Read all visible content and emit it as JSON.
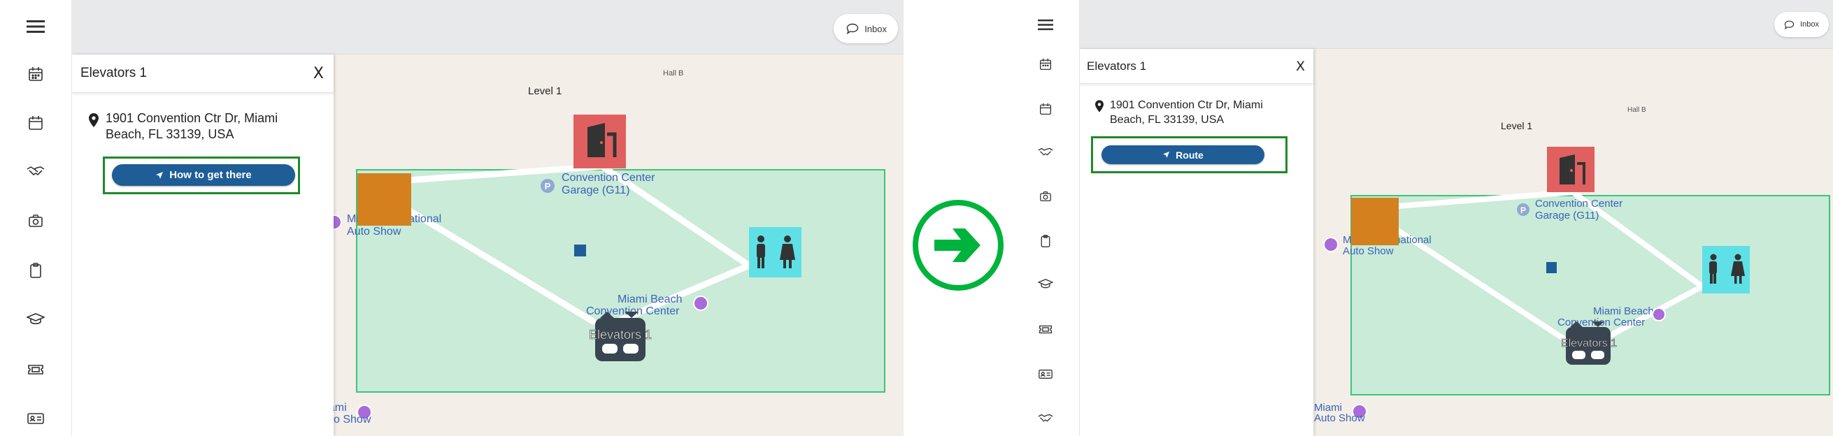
{
  "nav_icons": [
    "menu-icon",
    "calendar-grid-icon",
    "calendar-icon",
    "handshake-icon",
    "camera-icon",
    "clipboard-icon",
    "graduation-cap-icon",
    "ticket-icon",
    "id-card-icon",
    "handshake-icon"
  ],
  "inbox_label": "Inbox",
  "panel": {
    "title": "Elevators 1",
    "close_label": "X",
    "address": "1901 Convention Ctr Dr, Miami Beach, FL 33139, USA"
  },
  "before": {
    "action_label": "How to get there"
  },
  "after": {
    "action_label": "Route"
  },
  "map": {
    "hall_label": "Hall B",
    "level_label": "Level 1",
    "garage_label_1": "Convention Center",
    "garage_label_2": "Garage (G11)",
    "autoshow_label_1": "Miami International",
    "autoshow_label_2": "Auto Show",
    "center_label_1": "Miami Beach",
    "center_label_2": "Convention Center",
    "poi_bottom_1": "Miami",
    "poi_bottom_2": "Auto Show",
    "elevator_label": "Elevators 1"
  },
  "colors": {
    "zone_fill": "#c9ebd8",
    "zone_stroke": "#3cc47c",
    "door_marker": "#e06060",
    "orange_marker": "#d4801e",
    "restroom_marker": "#5ee0e6",
    "elevator_marker": "#3a4552",
    "primary_button": "#1f5d96",
    "highlight_border": "#1f8a2a",
    "arrow": "#00b33c"
  }
}
